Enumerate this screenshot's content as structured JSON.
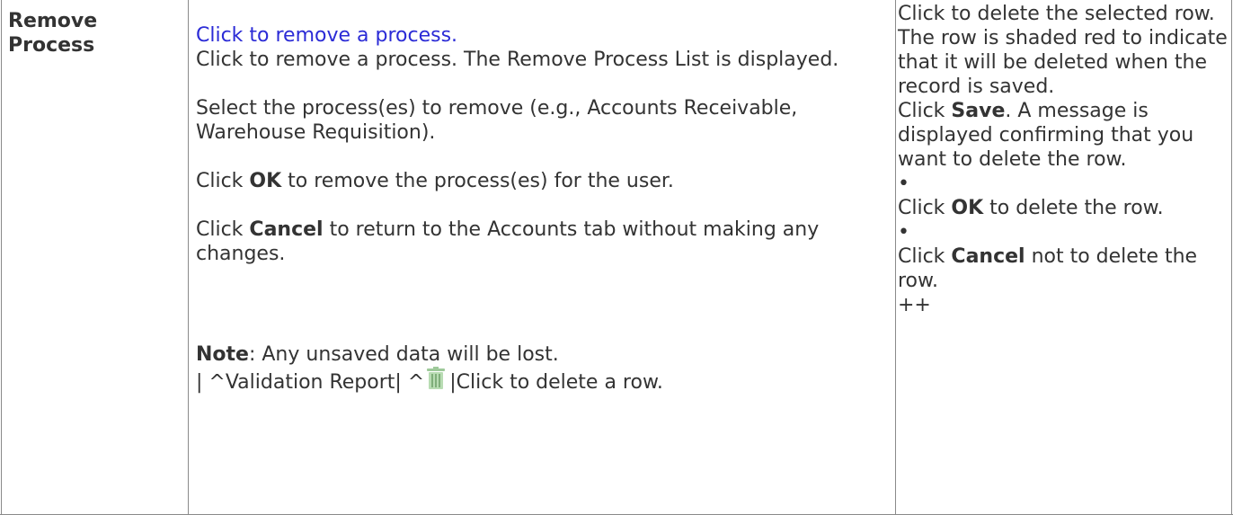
{
  "row_label": "Remove Process",
  "col2": {
    "link_text": "Click to remove a process.",
    "intro": "Click to remove a process. The Remove Process List is displayed.",
    "select_text": "Select the process(es) to remove (e.g., Accounts Receivable, Warehouse Requisition).",
    "ok_pre": "Click ",
    "ok_bold": "OK",
    "ok_post": " to remove the process(es) for the user.",
    "cancel_pre": "Click ",
    "cancel_bold": "Cancel",
    "cancel_post": " to return to the Accounts tab without making any changes.",
    "note_bold": "Note",
    "note_post": ": Any unsaved data will be lost.",
    "vr_pre": "| ^Validation Report| ^",
    "vr_post": "|Click to delete a row."
  },
  "col3": {
    "intro": "Click to delete the selected row. The row is shaded red to indicate that it will be deleted when the record is saved.",
    "save_pre": "Click ",
    "save_bold": "Save",
    "save_post": ". A message is displayed confirming that you want to delete the row.",
    "bullet1": "•",
    "ok_pre": "Click ",
    "ok_bold": "OK",
    "ok_post": " to delete the row.",
    "bullet2": "•",
    "cancel_pre": "Click ",
    "cancel_bold": "Cancel",
    "cancel_post": " not to delete the row.",
    "trailer": "++"
  },
  "icons": {
    "trash": "trash-icon"
  }
}
